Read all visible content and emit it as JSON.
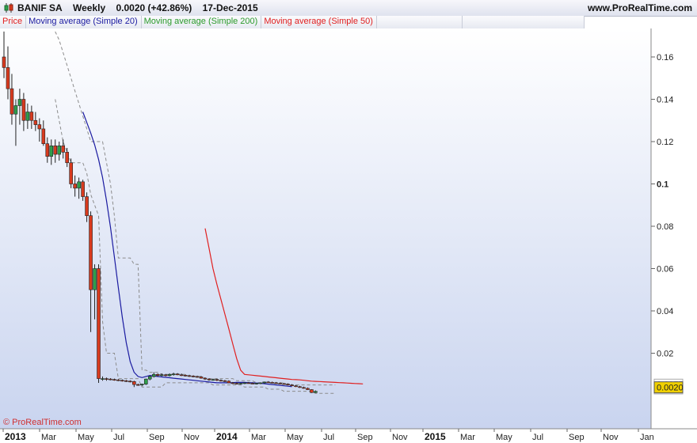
{
  "header": {
    "ticker": "BANIF SA",
    "period": "Weekly",
    "quote": "0.0020 (+42.86%)",
    "date": "17-Dec-2015",
    "site": "www.ProRealTime.com"
  },
  "legend": [
    {
      "label": "Price",
      "color": "#e02020"
    },
    {
      "label": "Moving average (Simple 20)",
      "color": "#1a1aa0"
    },
    {
      "label": "Moving average (Simple 200)",
      "color": "#2a9a2a"
    },
    {
      "label": "Moving average (Simple 50)",
      "color": "#e02020"
    }
  ],
  "watermark": "© ProRealTime.com",
  "colors": {
    "up": "#2e9e4a",
    "down": "#d83a1e",
    "sma20": "#1a1aa0",
    "sma50": "#e02020",
    "band": "#8c8c8c",
    "last_price_bg": "#f0d000"
  },
  "chart_data": {
    "type": "candlestick",
    "x_tick_labels": [
      "2013",
      "Mar",
      "May",
      "Jul",
      "Sep",
      "Nov",
      "2014",
      "Mar",
      "May",
      "Jul",
      "Sep",
      "Nov",
      "2015",
      "Mar",
      "May",
      "Jul",
      "Sep",
      "Nov",
      "Jan"
    ],
    "y_tick_labels": [
      "0.02",
      "0.04",
      "0.06",
      "0.08",
      "0.1",
      "0.12",
      "0.14",
      "0.16"
    ],
    "ylim": [
      0,
      0.17
    ],
    "last_price_label": "0.0020",
    "price_markers": [
      "0.0055",
      "0.0030"
    ],
    "ohlc": [
      [
        0.16,
        0.172,
        0.15,
        0.155
      ],
      [
        0.155,
        0.165,
        0.14,
        0.145
      ],
      [
        0.145,
        0.152,
        0.128,
        0.133
      ],
      [
        0.133,
        0.14,
        0.118,
        0.137
      ],
      [
        0.137,
        0.145,
        0.128,
        0.14
      ],
      [
        0.14,
        0.143,
        0.125,
        0.13
      ],
      [
        0.13,
        0.138,
        0.126,
        0.134
      ],
      [
        0.134,
        0.137,
        0.126,
        0.13
      ],
      [
        0.13,
        0.134,
        0.125,
        0.128
      ],
      [
        0.128,
        0.131,
        0.12,
        0.126
      ],
      [
        0.126,
        0.13,
        0.118,
        0.119
      ],
      [
        0.119,
        0.122,
        0.11,
        0.113
      ],
      [
        0.113,
        0.121,
        0.109,
        0.118
      ],
      [
        0.118,
        0.121,
        0.11,
        0.114
      ],
      [
        0.114,
        0.12,
        0.111,
        0.118
      ],
      [
        0.118,
        0.121,
        0.112,
        0.115
      ],
      [
        0.115,
        0.117,
        0.108,
        0.11
      ],
      [
        0.11,
        0.112,
        0.098,
        0.1
      ],
      [
        0.1,
        0.104,
        0.094,
        0.098
      ],
      [
        0.098,
        0.103,
        0.093,
        0.101
      ],
      [
        0.101,
        0.102,
        0.092,
        0.094
      ],
      [
        0.094,
        0.096,
        0.082,
        0.085
      ],
      [
        0.085,
        0.087,
        0.03,
        0.05
      ],
      [
        0.05,
        0.062,
        0.036,
        0.06
      ],
      [
        0.06,
        0.062,
        0.006,
        0.008
      ],
      [
        0.008,
        0.009,
        0.007,
        0.008
      ],
      [
        0.008,
        0.0085,
        0.007,
        0.0078
      ],
      [
        0.0078,
        0.0082,
        0.0072,
        0.0076
      ],
      [
        0.0076,
        0.008,
        0.007,
        0.0074
      ],
      [
        0.0074,
        0.0078,
        0.0068,
        0.0072
      ],
      [
        0.0072,
        0.0076,
        0.0066,
        0.007
      ],
      [
        0.007,
        0.0074,
        0.0064,
        0.0068
      ],
      [
        0.0068,
        0.0072,
        0.0062,
        0.0066
      ],
      [
        0.0066,
        0.007,
        0.004,
        0.0052
      ],
      [
        0.0052,
        0.0056,
        0.0046,
        0.005
      ],
      [
        0.005,
        0.0056,
        0.0044,
        0.0054
      ],
      [
        0.0054,
        0.008,
        0.005,
        0.0078
      ],
      [
        0.0078,
        0.0095,
        0.0072,
        0.009
      ],
      [
        0.009,
        0.011,
        0.0085,
        0.01
      ],
      [
        0.01,
        0.0105,
        0.0088,
        0.0095
      ],
      [
        0.0095,
        0.0105,
        0.009,
        0.0098
      ],
      [
        0.0098,
        0.0102,
        0.009,
        0.0094
      ],
      [
        0.0094,
        0.0105,
        0.009,
        0.01
      ],
      [
        0.01,
        0.0108,
        0.0094,
        0.0102
      ],
      [
        0.0102,
        0.0106,
        0.0096,
        0.0098
      ],
      [
        0.0098,
        0.0104,
        0.0092,
        0.0096
      ],
      [
        0.0096,
        0.01,
        0.009,
        0.0094
      ],
      [
        0.0094,
        0.0098,
        0.0088,
        0.0092
      ],
      [
        0.0092,
        0.0096,
        0.0086,
        0.009
      ],
      [
        0.009,
        0.0094,
        0.0084,
        0.0088
      ],
      [
        0.0088,
        0.0092,
        0.008,
        0.0082
      ],
      [
        0.0082,
        0.0086,
        0.0074,
        0.0078
      ],
      [
        0.0078,
        0.0082,
        0.007,
        0.0074
      ],
      [
        0.0074,
        0.008,
        0.007,
        0.0076
      ],
      [
        0.0076,
        0.008,
        0.0068,
        0.0072
      ],
      [
        0.0072,
        0.0076,
        0.0066,
        0.007
      ],
      [
        0.007,
        0.0074,
        0.0064,
        0.0068
      ],
      [
        0.0068,
        0.0072,
        0.0058,
        0.006
      ],
      [
        0.006,
        0.0064,
        0.0054,
        0.0058
      ],
      [
        0.0058,
        0.0062,
        0.0052,
        0.0056
      ],
      [
        0.0056,
        0.006,
        0.0052,
        0.0058
      ],
      [
        0.0058,
        0.0062,
        0.0054,
        0.006
      ],
      [
        0.006,
        0.0064,
        0.0056,
        0.0058
      ],
      [
        0.0058,
        0.0062,
        0.0054,
        0.0056
      ],
      [
        0.0056,
        0.006,
        0.0052,
        0.0058
      ],
      [
        0.0058,
        0.0062,
        0.0054,
        0.006
      ],
      [
        0.006,
        0.0066,
        0.0056,
        0.0064
      ],
      [
        0.0064,
        0.0068,
        0.006,
        0.0062
      ],
      [
        0.0062,
        0.0066,
        0.0058,
        0.006
      ],
      [
        0.006,
        0.0064,
        0.0056,
        0.0058
      ],
      [
        0.0058,
        0.0062,
        0.0054,
        0.0056
      ],
      [
        0.0056,
        0.006,
        0.0052,
        0.0054
      ],
      [
        0.0054,
        0.0058,
        0.0048,
        0.005
      ],
      [
        0.005,
        0.0054,
        0.0044,
        0.0046
      ],
      [
        0.0046,
        0.005,
        0.004,
        0.0042
      ],
      [
        0.0042,
        0.0046,
        0.0036,
        0.0038
      ],
      [
        0.0038,
        0.0042,
        0.0032,
        0.0034
      ],
      [
        0.0034,
        0.0038,
        0.0026,
        0.0028
      ],
      [
        0.0028,
        0.003,
        0.0012,
        0.0014
      ],
      [
        0.0014,
        0.0024,
        0.0012,
        0.002
      ]
    ],
    "sma20": [
      0.134,
      0.129,
      0.124,
      0.1185,
      0.1115,
      0.103,
      0.092,
      0.0795,
      0.0655,
      0.051,
      0.037,
      0.025,
      0.016,
      0.011,
      0.009,
      0.0085,
      0.009,
      0.0095,
      0.0092,
      0.009,
      0.0088,
      0.0086,
      0.0084,
      0.0082,
      0.008,
      0.0078,
      0.0076,
      0.0074,
      0.0072,
      0.007,
      0.0068,
      0.0066,
      0.0064,
      0.0062,
      0.006,
      0.006,
      0.006,
      0.006,
      0.0061,
      0.0062,
      0.0062,
      0.0062,
      0.0061,
      0.006,
      0.0059,
      0.0058,
      0.0056,
      0.0054,
      0.0052,
      0.005,
      0.0048,
      0.0046,
      0.0044,
      0.0042
    ],
    "sma50": [
      0.079,
      0.0695,
      0.06,
      0.0525,
      0.0455,
      0.0385,
      0.0315,
      0.0245,
      0.0175,
      0.012,
      0.01,
      0.0098,
      0.0096,
      0.0094,
      0.0092,
      0.009,
      0.0088,
      0.0086,
      0.0084,
      0.0082,
      0.008,
      0.0078,
      0.0076,
      0.0075,
      0.0074,
      0.0072,
      0.007,
      0.0068,
      0.0067,
      0.0066,
      0.0065,
      0.0064,
      0.0063,
      0.0062,
      0.0061,
      0.006,
      0.0059,
      0.0058,
      0.0057,
      0.0056,
      0.0055
    ],
    "band_upper": [
      0.172,
      0.168,
      0.162,
      0.156,
      0.15,
      0.144,
      0.138,
      0.132,
      0.126,
      0.12,
      0.12,
      0.12,
      0.12,
      0.11,
      0.1,
      0.085,
      0.065,
      0.065,
      0.065,
      0.065,
      0.062,
      0.062,
      0.012,
      0.012,
      0.011,
      0.011,
      0.011,
      0.01,
      0.01,
      0.01,
      0.01,
      0.01,
      0.01,
      0.01,
      0.009,
      0.009,
      0.009,
      0.009,
      0.008,
      0.008,
      0.008,
      0.008,
      0.008,
      0.008,
      0.008,
      0.008,
      0.007,
      0.007,
      0.007,
      0.007,
      0.007,
      0.006,
      0.006,
      0.006,
      0.006,
      0.006,
      0.006,
      0.006,
      0.006,
      0.005,
      0.005,
      0.005,
      0.005,
      0.005,
      0.005,
      0.005,
      0.005,
      0.005,
      0.005,
      0.005,
      0.005,
      0.005
    ],
    "band_lower": [
      0.14,
      0.13,
      0.12,
      0.115,
      0.11,
      0.11,
      0.11,
      0.11,
      0.105,
      0.095,
      0.09,
      0.085,
      0.035,
      0.02,
      0.02,
      0.02,
      0.008,
      0.008,
      0.008,
      0.008,
      0.008,
      0.008,
      0.004,
      0.004,
      0.004,
      0.004,
      0.004,
      0.004,
      0.006,
      0.006,
      0.006,
      0.006,
      0.006,
      0.006,
      0.006,
      0.006,
      0.006,
      0.006,
      0.006,
      0.006,
      0.005,
      0.005,
      0.005,
      0.005,
      0.005,
      0.005,
      0.005,
      0.005,
      0.004,
      0.004,
      0.004,
      0.004,
      0.004,
      0.004,
      0.003,
      0.003,
      0.003,
      0.003,
      0.002,
      0.002,
      0.002,
      0.002,
      0.002,
      0.002,
      0.002,
      0.002,
      0.001,
      0.001,
      0.001,
      0.001,
      0.001,
      0.001
    ]
  }
}
